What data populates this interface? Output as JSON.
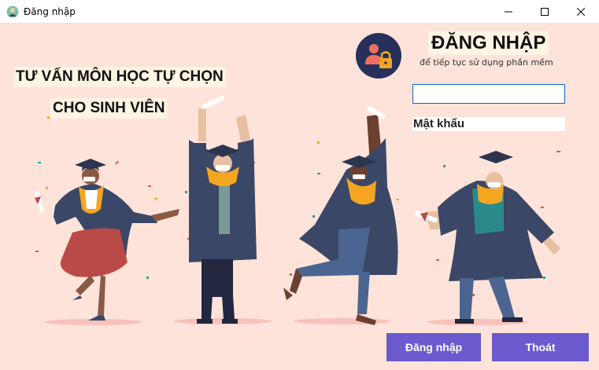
{
  "window": {
    "title": "Đăng nhập",
    "controls": [
      "minimize",
      "maximize",
      "close"
    ]
  },
  "hero": {
    "line1": "TƯ VẤN MÔN HỌC TỰ CHỌN",
    "line2": "CHO SINH VIÊN"
  },
  "login": {
    "title": "ĐĂNG NHẬP",
    "subtitle": "để tiếp tục sử dụng phần mềm",
    "username_value": "",
    "password_placeholder": "Mật khẩu"
  },
  "buttons": {
    "login": "Đăng nhập",
    "exit": "Thoát"
  },
  "colors": {
    "background": "#fde3d9",
    "button": "#6a5acd",
    "gown": "#3b4766",
    "stole": "#f4a620"
  }
}
